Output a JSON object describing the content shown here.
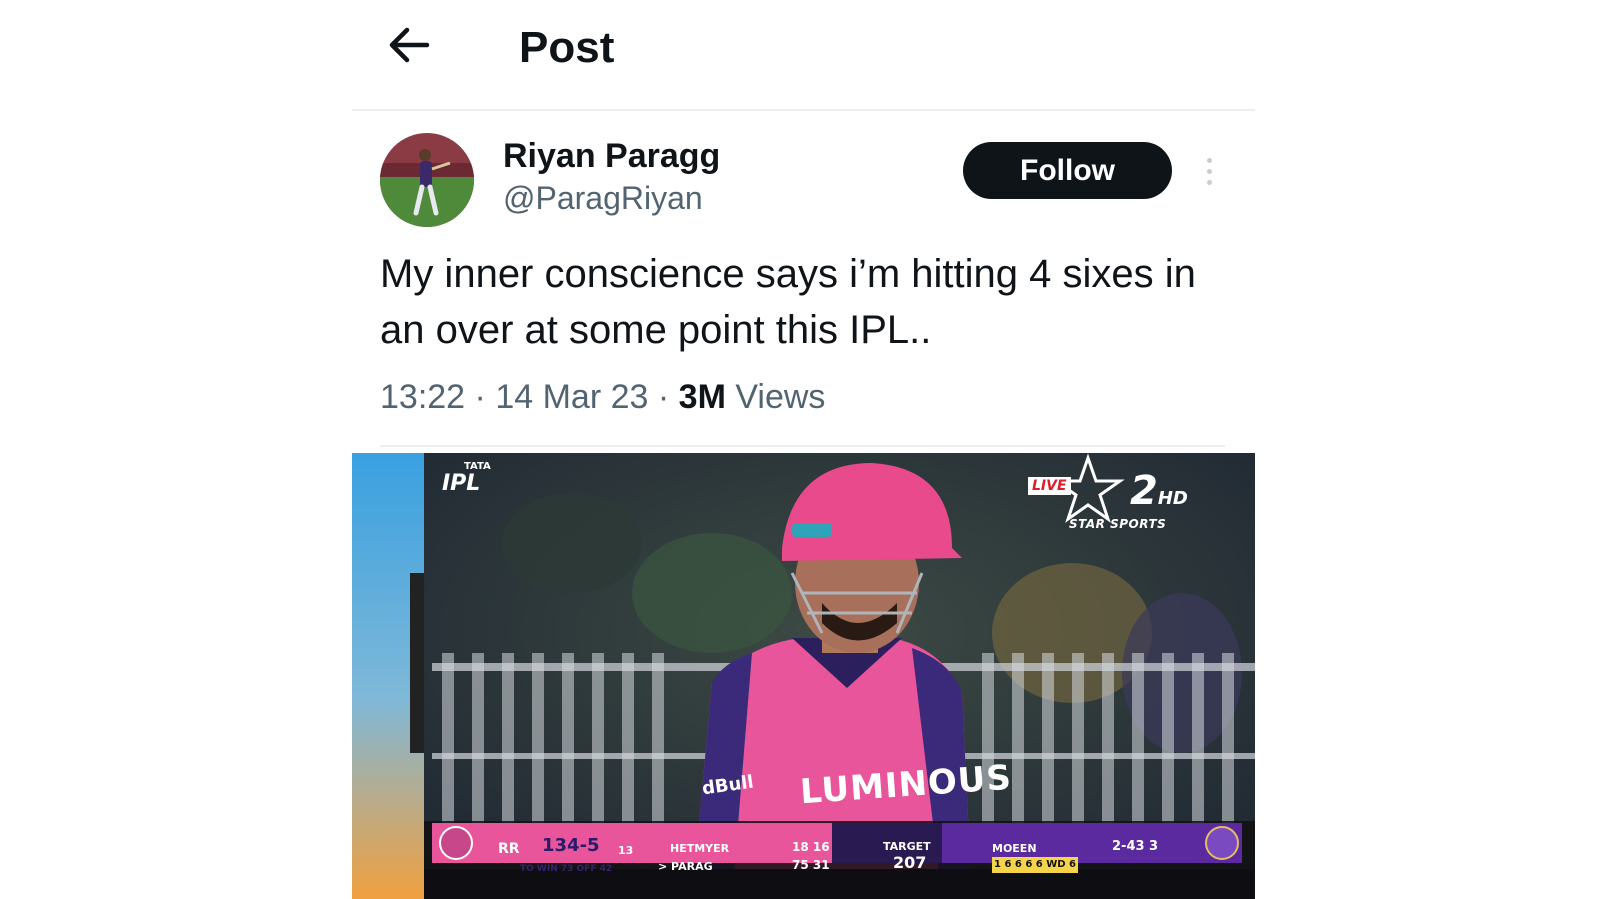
{
  "header": {
    "title": "Post",
    "back_icon": "arrow-left-icon"
  },
  "author": {
    "display_name": "Riyan Paragg",
    "handle": "@ParagRiyan",
    "follow_label": "Follow",
    "more_icon": "more-vertical-icon"
  },
  "post": {
    "text": "My inner conscience says i’m hitting 4 sixes in an over at some point this IPL..",
    "time": "13:22",
    "date": "14 Mar 23",
    "views_count": "3M",
    "views_label": "Views"
  },
  "media": {
    "ipl_tata": "TATA",
    "ipl_text": "IPL",
    "live": "LIVE",
    "channel": "2",
    "channel_hd": "HD",
    "network": "STAR SPORTS",
    "jersey": "LUMINOUS",
    "sponsor": "dBull",
    "scoreboard": {
      "team": "RR",
      "score": "134-5",
      "overs": "13",
      "to_win": "TO WIN 73 OFF 42",
      "batter1": "HETMYER",
      "batter1_runs": "18 16",
      "batter2": "> PARAG",
      "batter2_runs": "75 31",
      "target_label": "TARGET",
      "target": "207",
      "bowler": "MOEEN",
      "bowler_figures": "2-43 3",
      "balls": "1 6 6 6 6 WD 6"
    }
  },
  "colors": {
    "follow_bg": "#0f1419",
    "secondary_text": "#536471",
    "helmet_pink": "#e84a8b",
    "scoreboard_pink": "#e8559b",
    "scoreboard_purple": "#5a2a9e"
  }
}
